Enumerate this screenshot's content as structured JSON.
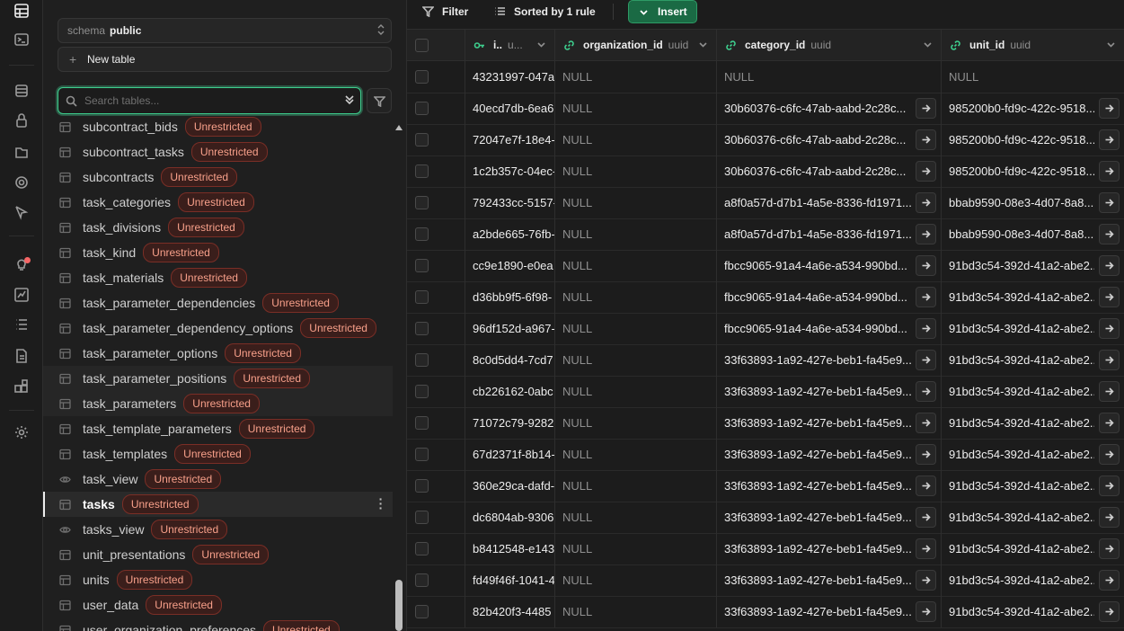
{
  "rail": {
    "icons": [
      "table-editor-icon",
      "sql-editor-icon",
      "database-icon",
      "auth-icon",
      "storage-icon",
      "realtime-icon",
      "edge-functions-icon",
      "advisors-icon",
      "reports-icon",
      "logs-icon",
      "api-docs-icon",
      "integrations-icon",
      "settings-icon"
    ]
  },
  "sidebar": {
    "schema_label": "schema",
    "schema_value": "public",
    "new_table_label": "New table",
    "search_placeholder": "Search tables...",
    "tables": [
      {
        "name": "subcontract_bids",
        "badge": "Unrestricted",
        "kind": "table"
      },
      {
        "name": "subcontract_tasks",
        "badge": "Unrestricted",
        "kind": "table"
      },
      {
        "name": "subcontracts",
        "badge": "Unrestricted",
        "kind": "table"
      },
      {
        "name": "task_categories",
        "badge": "Unrestricted",
        "kind": "table"
      },
      {
        "name": "task_divisions",
        "badge": "Unrestricted",
        "kind": "table"
      },
      {
        "name": "task_kind",
        "badge": "Unrestricted",
        "kind": "table"
      },
      {
        "name": "task_materials",
        "badge": "Unrestricted",
        "kind": "table"
      },
      {
        "name": "task_parameter_dependencies",
        "badge": "Unrestricted",
        "kind": "table"
      },
      {
        "name": "task_parameter_dependency_options",
        "badge": "Unrestricted",
        "kind": "table"
      },
      {
        "name": "task_parameter_options",
        "badge": "Unrestricted",
        "kind": "table"
      },
      {
        "name": "task_parameter_positions",
        "badge": "Unrestricted",
        "kind": "table"
      },
      {
        "name": "task_parameters",
        "badge": "Unrestricted",
        "kind": "table"
      },
      {
        "name": "task_template_parameters",
        "badge": "Unrestricted",
        "kind": "table"
      },
      {
        "name": "task_templates",
        "badge": "Unrestricted",
        "kind": "table"
      },
      {
        "name": "task_view",
        "badge": "Unrestricted",
        "kind": "view"
      },
      {
        "name": "tasks",
        "badge": "Unrestricted",
        "kind": "table"
      },
      {
        "name": "tasks_view",
        "badge": "Unrestricted",
        "kind": "view"
      },
      {
        "name": "unit_presentations",
        "badge": "Unrestricted",
        "kind": "table"
      },
      {
        "name": "units",
        "badge": "Unrestricted",
        "kind": "table"
      },
      {
        "name": "user_data",
        "badge": "Unrestricted",
        "kind": "table"
      },
      {
        "name": "user_organization_preferences",
        "badge": "Unrestricted",
        "kind": "table"
      }
    ],
    "active_table": "tasks"
  },
  "toolbar": {
    "filter_label": "Filter",
    "sort_label": "Sorted by 1 rule",
    "insert_label": "Insert"
  },
  "grid": {
    "columns": [
      {
        "name": "i..",
        "type": "u...",
        "icon": "key-icon"
      },
      {
        "name": "organization_id",
        "type": "uuid",
        "icon": "link-icon"
      },
      {
        "name": "category_id",
        "type": "uuid",
        "icon": "link-icon"
      },
      {
        "name": "unit_id",
        "type": "uuid",
        "icon": "link-icon"
      }
    ],
    "null_text": "NULL",
    "rows": [
      {
        "id": "43231997-047a-",
        "organization_id": "NULL",
        "category_id": "NULL",
        "unit_id": "NULL"
      },
      {
        "id": "40ecd7db-6ea6",
        "organization_id": "NULL",
        "category_id": "30b60376-c6fc-47ab-aabd-2c28c...",
        "unit_id": "985200b0-fd9c-422c-9518..."
      },
      {
        "id": "72047e7f-18e4-",
        "organization_id": "NULL",
        "category_id": "30b60376-c6fc-47ab-aabd-2c28c...",
        "unit_id": "985200b0-fd9c-422c-9518..."
      },
      {
        "id": "1c2b357c-04ec-",
        "organization_id": "NULL",
        "category_id": "30b60376-c6fc-47ab-aabd-2c28c...",
        "unit_id": "985200b0-fd9c-422c-9518..."
      },
      {
        "id": "792433cc-5157-",
        "organization_id": "NULL",
        "category_id": "a8f0a57d-d7b1-4a5e-8336-fd1971...",
        "unit_id": "bbab9590-08e3-4d07-8a8..."
      },
      {
        "id": "a2bde665-76fb-",
        "organization_id": "NULL",
        "category_id": "a8f0a57d-d7b1-4a5e-8336-fd1971...",
        "unit_id": "bbab9590-08e3-4d07-8a8..."
      },
      {
        "id": "cc9e1890-e0ea",
        "organization_id": "NULL",
        "category_id": "fbcc9065-91a4-4a6e-a534-990bd...",
        "unit_id": "91bd3c54-392d-41a2-abe2..."
      },
      {
        "id": "d36bb9f5-6f98-",
        "organization_id": "NULL",
        "category_id": "fbcc9065-91a4-4a6e-a534-990bd...",
        "unit_id": "91bd3c54-392d-41a2-abe2..."
      },
      {
        "id": "96df152d-a967-",
        "organization_id": "NULL",
        "category_id": "fbcc9065-91a4-4a6e-a534-990bd...",
        "unit_id": "91bd3c54-392d-41a2-abe2..."
      },
      {
        "id": "8c0d5dd4-7cd7",
        "organization_id": "NULL",
        "category_id": "33f63893-1a92-427e-beb1-fa45e9...",
        "unit_id": "91bd3c54-392d-41a2-abe2..."
      },
      {
        "id": "cb226162-0abc",
        "organization_id": "NULL",
        "category_id": "33f63893-1a92-427e-beb1-fa45e9...",
        "unit_id": "91bd3c54-392d-41a2-abe2..."
      },
      {
        "id": "71072c79-9282-",
        "organization_id": "NULL",
        "category_id": "33f63893-1a92-427e-beb1-fa45e9...",
        "unit_id": "91bd3c54-392d-41a2-abe2..."
      },
      {
        "id": "67d2371f-8b14-",
        "organization_id": "NULL",
        "category_id": "33f63893-1a92-427e-beb1-fa45e9...",
        "unit_id": "91bd3c54-392d-41a2-abe2..."
      },
      {
        "id": "360e29ca-dafd-",
        "organization_id": "NULL",
        "category_id": "33f63893-1a92-427e-beb1-fa45e9...",
        "unit_id": "91bd3c54-392d-41a2-abe2..."
      },
      {
        "id": "dc6804ab-9306",
        "organization_id": "NULL",
        "category_id": "33f63893-1a92-427e-beb1-fa45e9...",
        "unit_id": "91bd3c54-392d-41a2-abe2..."
      },
      {
        "id": "b8412548-e143-",
        "organization_id": "NULL",
        "category_id": "33f63893-1a92-427e-beb1-fa45e9...",
        "unit_id": "91bd3c54-392d-41a2-abe2..."
      },
      {
        "id": "fd49f46f-1041-4",
        "organization_id": "NULL",
        "category_id": "33f63893-1a92-427e-beb1-fa45e9...",
        "unit_id": "91bd3c54-392d-41a2-abe2..."
      },
      {
        "id": "82b420f3-4485",
        "organization_id": "NULL",
        "category_id": "33f63893-1a92-427e-beb1-fa45e9...",
        "unit_id": "91bd3c54-392d-41a2-abe2..."
      }
    ]
  }
}
